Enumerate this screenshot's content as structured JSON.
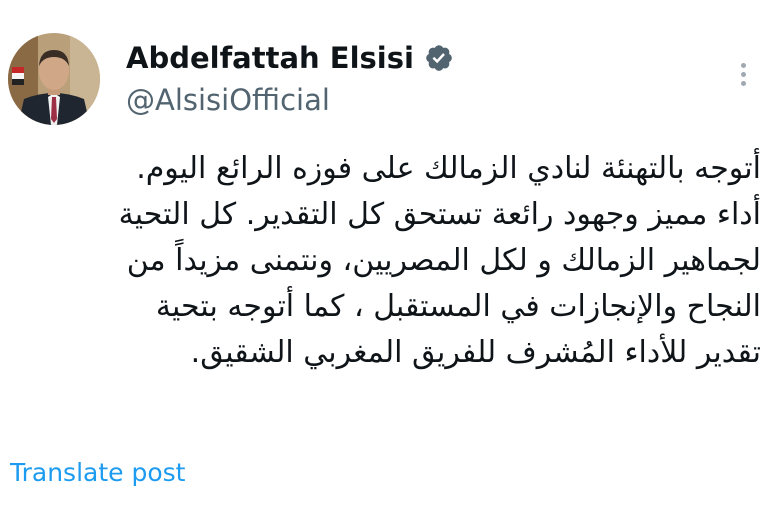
{
  "author": {
    "display_name": "Abdelfattah Elsisi",
    "handle": "@AlsisiOfficial",
    "avatar_icon": "portrait-photo",
    "verified_icon": "verified-badge-icon",
    "verified_color": "#536471"
  },
  "menu": {
    "more_icon": "more-vertical-icon"
  },
  "post": {
    "lines": [
      "أتوجه بالتهنئة لنادي الزمالك على فوزه الرائع اليوم.",
      "أداء مميز وجهود رائعة تستحق كل التقدير. كل التحية",
      "لجماهير الزمالك و لكل المصريين، ونتمنى مزيداً من",
      "النجاح والإنجازات في المستقبل ، كما أتوجه بتحية",
      "تقدير للأداء المُشرف للفريق المغربي الشقيق."
    ]
  },
  "actions": {
    "translate_label": "Translate post"
  },
  "colors": {
    "text": "#0f1419",
    "secondary": "#536471",
    "link": "#1d9bf0"
  }
}
